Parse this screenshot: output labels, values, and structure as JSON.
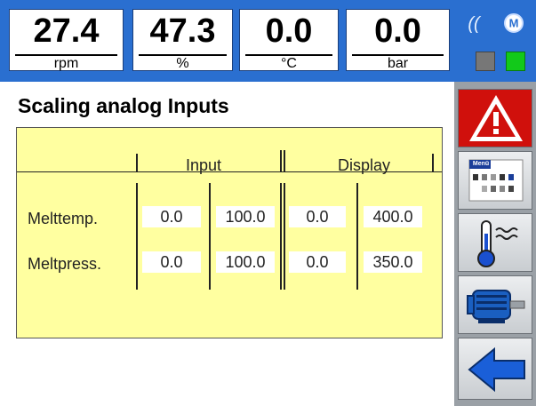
{
  "status_bar": {
    "gauges": [
      {
        "value": "27.4",
        "unit": "rpm"
      },
      {
        "value": "47.3",
        "unit": "%"
      },
      {
        "value": "0.0",
        "unit": "°C"
      },
      {
        "value": "0.0",
        "unit": "bar"
      }
    ],
    "signal_icon": "((",
    "indicators": [
      {
        "name": "status-gray-indicator",
        "color": "#777777"
      },
      {
        "name": "status-green-indicator",
        "color": "#12c91a"
      }
    ],
    "accent_color": "#2a6fd0"
  },
  "page": {
    "title": "Scaling analog Inputs"
  },
  "table": {
    "headers": {
      "input": "Input",
      "display": "Display"
    },
    "rows": [
      {
        "label": "Melttemp.",
        "input_min": "0.0",
        "input_max": "100.0",
        "display_min": "0.0",
        "display_max": "400.0"
      },
      {
        "label": "Meltpress.",
        "input_min": "0.0",
        "input_max": "100.0",
        "display_min": "0.0",
        "display_max": "350.0"
      }
    ],
    "panel_color": "#ffffa0"
  },
  "sidebar": {
    "buttons": [
      {
        "name": "alarm-button",
        "icon": "warning-triangle-icon"
      },
      {
        "name": "menu-button",
        "icon": "menu-icon",
        "label": "Menü"
      },
      {
        "name": "temperature-button",
        "icon": "thermometer-icon"
      },
      {
        "name": "motor-button",
        "icon": "motor-icon"
      },
      {
        "name": "back-button",
        "icon": "arrow-left-icon"
      }
    ]
  }
}
